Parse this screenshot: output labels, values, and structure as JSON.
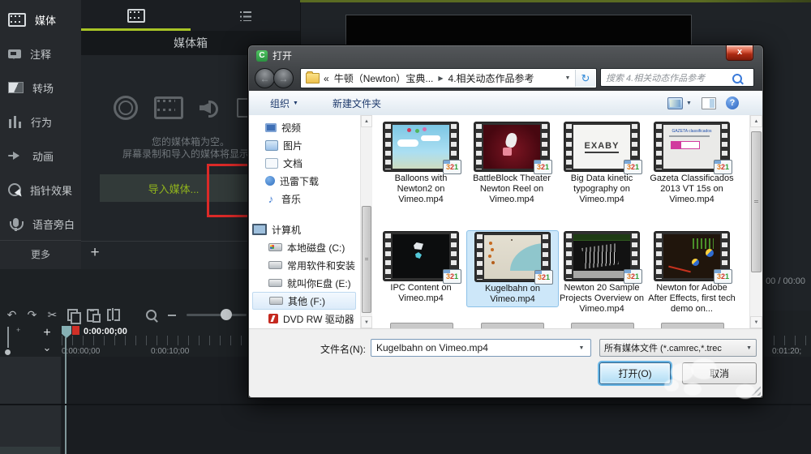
{
  "colors": {
    "accent_green": "#a8c426",
    "import_green": "#90b31d",
    "annotation_red": "#dc2a28",
    "selection_blue": "#cde7f9",
    "dialog_default_btn_border": "#69b5e4"
  },
  "glyphs": {
    "back": "←",
    "forward": "→",
    "caret_down": "▼",
    "refresh": "↻",
    "overflow": "«",
    "crumb_sep": "▶",
    "close_x": "x",
    "help": "?",
    "music_note": "♪",
    "undo": "↶",
    "redo": "↷",
    "scissors": "✂",
    "plus": "+",
    "chevron_down": "⌄",
    "scroll_up": "▲",
    "scroll_down": "▼"
  },
  "app": {
    "sidebar": {
      "items": [
        {
          "label": "媒体"
        },
        {
          "label": "注释"
        },
        {
          "label": "转场"
        },
        {
          "label": "行为"
        },
        {
          "label": "动画"
        },
        {
          "label": "指针效果"
        },
        {
          "label": "语音旁白"
        }
      ],
      "more_label": "更多"
    },
    "media_bin": {
      "title": "媒体箱",
      "empty_line1": "您的媒体箱为空。",
      "empty_line2": "屏幕录制和导入的媒体将显示在",
      "import_button": "导入媒体..."
    },
    "preview": {
      "time_text": "00 / 00:00"
    },
    "timeline": {
      "playhead_time": "0:00:00;00",
      "label_0": "0:00:00;00",
      "label_10": "0:00:10;00",
      "label_right": "0:01:20;"
    }
  },
  "dialog": {
    "title": "打开",
    "breadcrumb": {
      "folder_parent": "牛顿（Newton）宝典...",
      "folder_current": "4.相关动态作品参考"
    },
    "search_text": "搜索 4.相关动态作品参考",
    "toolbar": {
      "organize": "组织",
      "new_folder": "新建文件夹"
    },
    "nav": [
      {
        "label": "视频"
      },
      {
        "label": "图片"
      },
      {
        "label": "文档"
      },
      {
        "label": "迅雷下载"
      },
      {
        "label": "音乐"
      },
      {
        "label": "计算机"
      },
      {
        "label": "本地磁盘 (C:)"
      },
      {
        "label": "常用软件和安装"
      },
      {
        "label": "就叫你E盘 (E:)"
      },
      {
        "label": "其他 (F:)"
      },
      {
        "label": "DVD RW 驱动器"
      }
    ],
    "files": [
      {
        "name": "Balloons with Newton2 on Vimeo.mp4"
      },
      {
        "name": "BattleBlock Theater Newton Reel on Vimeo.mp4"
      },
      {
        "name": "Big Data kinetic typography on Vimeo.mp4",
        "thumb_text": "EXABY"
      },
      {
        "name": "Gazeta Classificados 2013 VT 15s on Vimeo.mp4",
        "thumb_text": "GAZETA classificados"
      },
      {
        "name": "IPC Content on Vimeo.mp4"
      },
      {
        "name": "Kugelbahn on Vimeo.mp4"
      },
      {
        "name": "Newton 20 Sample Projects Overview on Vimeo.mp4"
      },
      {
        "name": "Newton for Adobe After Effects, first tech demo on..."
      }
    ],
    "badge": {
      "d1": "3",
      "d2": "2",
      "d3": "1"
    },
    "filename_label": "文件名(N):",
    "filename_value": "Kugelbahn on Vimeo.mp4",
    "filetype_value": "所有媒体文件 (*.camrec,*.trec",
    "open_button": "打开(O)",
    "cancel_button": "取消"
  }
}
